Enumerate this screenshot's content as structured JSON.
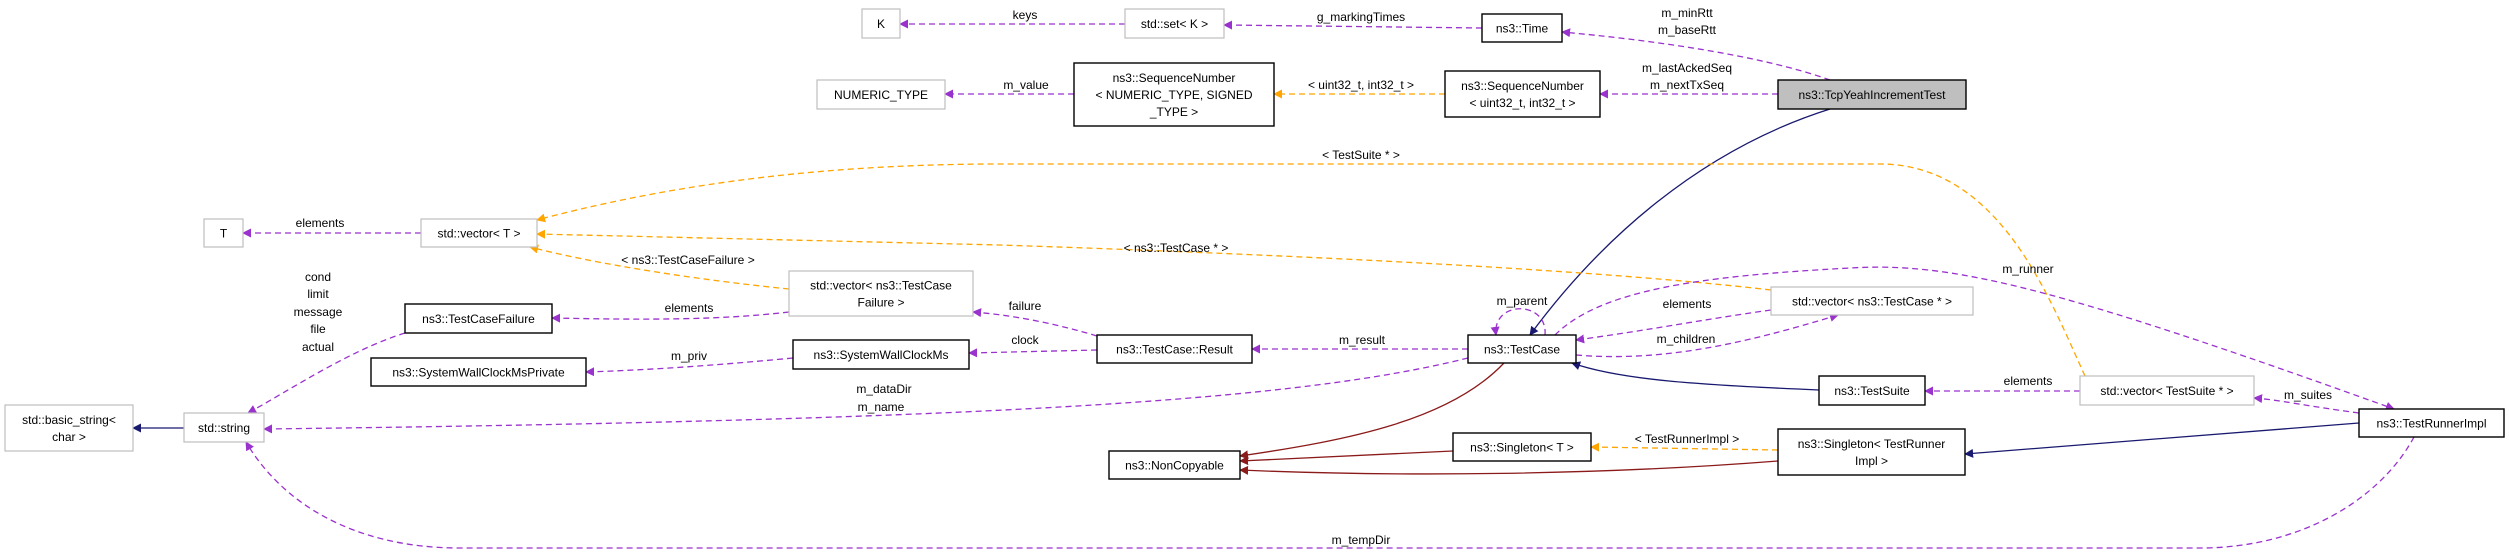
{
  "colors": {
    "usage": "#9a32cd",
    "template": "#ffa500",
    "public_inheritance": "#191970",
    "private_inheritance": "#8b1a1a",
    "focus_fill": "#bfbfbf",
    "documented_border": "#000000",
    "undocumented_border": "#bfbfbf"
  },
  "nodes": [
    {
      "id": "K",
      "lines": [
        "K"
      ],
      "style": "undocumented"
    },
    {
      "id": "set_K",
      "lines": [
        "std::set< K >"
      ],
      "style": "undocumented"
    },
    {
      "id": "time",
      "lines": [
        "ns3::Time"
      ],
      "style": "documented"
    },
    {
      "id": "numeric_type",
      "lines": [
        "NUMERIC_TYPE"
      ],
      "style": "undocumented"
    },
    {
      "id": "seq_generic",
      "lines": [
        "ns3::SequenceNumber",
        "< NUMERIC_TYPE, SIGNED",
        "_TYPE >"
      ],
      "style": "documented"
    },
    {
      "id": "seq_uint32",
      "lines": [
        "ns3::SequenceNumber",
        "< uint32_t, int32_t >"
      ],
      "style": "documented"
    },
    {
      "id": "tcp_yeah",
      "lines": [
        "ns3::TcpYeahIncrementTest"
      ],
      "style": "focus"
    },
    {
      "id": "T",
      "lines": [
        "T"
      ],
      "style": "undocumented"
    },
    {
      "id": "vector_T",
      "lines": [
        "std::vector< T >"
      ],
      "style": "undocumented"
    },
    {
      "id": "vector_tcf",
      "lines": [
        "std::vector< ns3::TestCase",
        "Failure >"
      ],
      "style": "undocumented"
    },
    {
      "id": "test_case_failure",
      "lines": [
        "ns3::TestCaseFailure"
      ],
      "style": "documented"
    },
    {
      "id": "swcm_private",
      "lines": [
        "ns3::SystemWallClockMsPrivate"
      ],
      "style": "documented"
    },
    {
      "id": "swcm",
      "lines": [
        "ns3::SystemWallClockMs"
      ],
      "style": "documented"
    },
    {
      "id": "result",
      "lines": [
        "ns3::TestCase::Result"
      ],
      "style": "documented"
    },
    {
      "id": "test_case",
      "lines": [
        "ns3::TestCase"
      ],
      "style": "documented"
    },
    {
      "id": "vector_tc",
      "lines": [
        "std::vector< ns3::TestCase * >"
      ],
      "style": "undocumented"
    },
    {
      "id": "basic_string",
      "lines": [
        "std::basic_string<",
        "char >"
      ],
      "style": "undocumented"
    },
    {
      "id": "string",
      "lines": [
        "std::string"
      ],
      "style": "undocumented"
    },
    {
      "id": "test_suite",
      "lines": [
        "ns3::TestSuite"
      ],
      "style": "documented"
    },
    {
      "id": "vector_ts",
      "lines": [
        "std::vector< TestSuite * >"
      ],
      "style": "undocumented"
    },
    {
      "id": "test_runner_impl",
      "lines": [
        "ns3::TestRunnerImpl"
      ],
      "style": "documented"
    },
    {
      "id": "non_copyable",
      "lines": [
        "ns3::NonCopyable"
      ],
      "style": "documented"
    },
    {
      "id": "singleton_T",
      "lines": [
        "ns3::Singleton< T >"
      ],
      "style": "documented"
    },
    {
      "id": "singleton_tri",
      "lines": [
        "ns3::Singleton< TestRunner",
        "Impl >"
      ],
      "style": "documented"
    }
  ],
  "edges": [
    {
      "from": "set_K",
      "to": "K",
      "kind": "usage",
      "labels": [
        "keys"
      ]
    },
    {
      "from": "time",
      "to": "set_K",
      "kind": "usage",
      "labels": [
        "g_markingTimes"
      ]
    },
    {
      "from": "tcp_yeah",
      "to": "time",
      "kind": "usage",
      "labels": [
        "m_minRtt",
        "m_baseRtt"
      ]
    },
    {
      "from": "seq_uint32",
      "to": "seq_generic",
      "kind": "template",
      "labels": [
        "< uint32_t, int32_t >"
      ]
    },
    {
      "from": "seq_generic",
      "to": "numeric_type",
      "kind": "usage",
      "labels": [
        "m_value"
      ]
    },
    {
      "from": "tcp_yeah",
      "to": "seq_uint32",
      "kind": "usage",
      "labels": [
        "m_lastAckedSeq",
        "m_nextTxSeq"
      ]
    },
    {
      "from": "tcp_yeah",
      "to": "test_case",
      "kind": "public_inheritance",
      "labels": []
    },
    {
      "from": "vector_ts",
      "to": "vector_T",
      "kind": "template",
      "labels": [
        "< TestSuite * >"
      ]
    },
    {
      "from": "vector_tc",
      "to": "vector_T",
      "kind": "template",
      "labels": [
        "< ns3::TestCase * >"
      ]
    },
    {
      "from": "vector_tcf",
      "to": "vector_T",
      "kind": "template",
      "labels": [
        "< ns3::TestCaseFailure >"
      ]
    },
    {
      "from": "vector_T",
      "to": "T",
      "kind": "usage",
      "labels": [
        "elements"
      ]
    },
    {
      "from": "vector_tcf",
      "to": "test_case_failure",
      "kind": "usage",
      "labels": [
        "elements"
      ]
    },
    {
      "from": "test_case_failure",
      "to": "string",
      "kind": "usage",
      "labels": [
        "cond",
        "limit",
        "message",
        "file",
        "actual"
      ]
    },
    {
      "from": "swcm",
      "to": "swcm_private",
      "kind": "usage",
      "labels": [
        "m_priv"
      ]
    },
    {
      "from": "result",
      "to": "vector_tcf",
      "kind": "usage",
      "labels": [
        "failure"
      ]
    },
    {
      "from": "result",
      "to": "swcm",
      "kind": "usage",
      "labels": [
        "clock"
      ]
    },
    {
      "from": "test_case",
      "to": "result",
      "kind": "usage",
      "labels": [
        "m_result"
      ]
    },
    {
      "from": "test_case",
      "to": "string",
      "kind": "usage",
      "labels": [
        "m_dataDir",
        "m_name"
      ]
    },
    {
      "from": "test_case",
      "to": "test_case",
      "kind": "usage",
      "labels": [
        "m_parent"
      ]
    },
    {
      "from": "test_case",
      "to": "vector_tc",
      "kind": "usage",
      "labels": [
        "m_children"
      ]
    },
    {
      "from": "vector_tc",
      "to": "test_case",
      "kind": "usage",
      "labels": [
        "elements"
      ]
    },
    {
      "from": "test_case",
      "to": "test_runner_impl",
      "kind": "usage",
      "labels": [
        "m_runner"
      ]
    },
    {
      "from": "test_runner_impl",
      "to": "vector_ts",
      "kind": "usage",
      "labels": [
        "m_suites"
      ]
    },
    {
      "from": "vector_ts",
      "to": "test_suite",
      "kind": "usage",
      "labels": [
        "elements"
      ]
    },
    {
      "from": "test_suite",
      "to": "test_case",
      "kind": "public_inheritance",
      "labels": []
    },
    {
      "from": "test_runner_impl",
      "to": "singleton_tri",
      "kind": "public_inheritance",
      "labels": []
    },
    {
      "from": "singleton_tri",
      "to": "singleton_T",
      "kind": "template",
      "labels": [
        "< TestRunnerImpl >"
      ]
    },
    {
      "from": "singleton_T",
      "to": "non_copyable",
      "kind": "private_inheritance",
      "labels": []
    },
    {
      "from": "test_case",
      "to": "non_copyable",
      "kind": "private_inheritance",
      "labels": []
    },
    {
      "from": "singleton_tri",
      "to": "non_copyable",
      "kind": "private_inheritance",
      "labels": []
    },
    {
      "from": "test_runner_impl",
      "to": "string",
      "kind": "usage",
      "labels": [
        "m_tempDir"
      ]
    },
    {
      "from": "string",
      "to": "basic_string",
      "kind": "public_inheritance",
      "labels": []
    }
  ]
}
